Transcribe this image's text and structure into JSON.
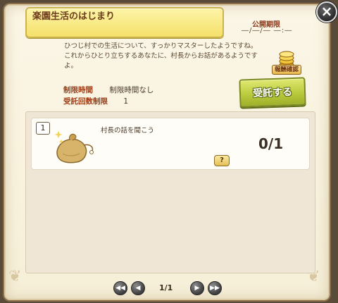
{
  "dialog": {
    "title": "楽園生活のはじまり",
    "period_label": "公開期限",
    "period_value": "―/―/― ―:―",
    "description": [
      "ひつじ村での生活について、すっかりマスターしたようですね。",
      "これからひとり立ちするあなたに、村長からお話があるようですよ。"
    ],
    "reward_label": "報酬確認",
    "time_limit_label": "制限時間",
    "time_limit_value": "制限時間なし",
    "accept_count_label": "受託回数制限",
    "accept_count_value": "1",
    "accept_button": "受託する",
    "close_icon": "×"
  },
  "quests": [
    {
      "number": "1",
      "name": "村長の話を聞こう",
      "progress": "0/1",
      "help_label": "?",
      "icon": "money-bag-icon"
    }
  ],
  "pager": {
    "page": "1/1",
    "first_icon": "double-left-arrow",
    "prev_icon": "left-arrow",
    "next_icon": "right-arrow",
    "last_icon": "double-right-arrow"
  },
  "colors": {
    "title_bg": "#f5e06a",
    "accept_bg": "#b7c83a",
    "label_red": "#a13a12",
    "parchment": "#f6efd8"
  }
}
